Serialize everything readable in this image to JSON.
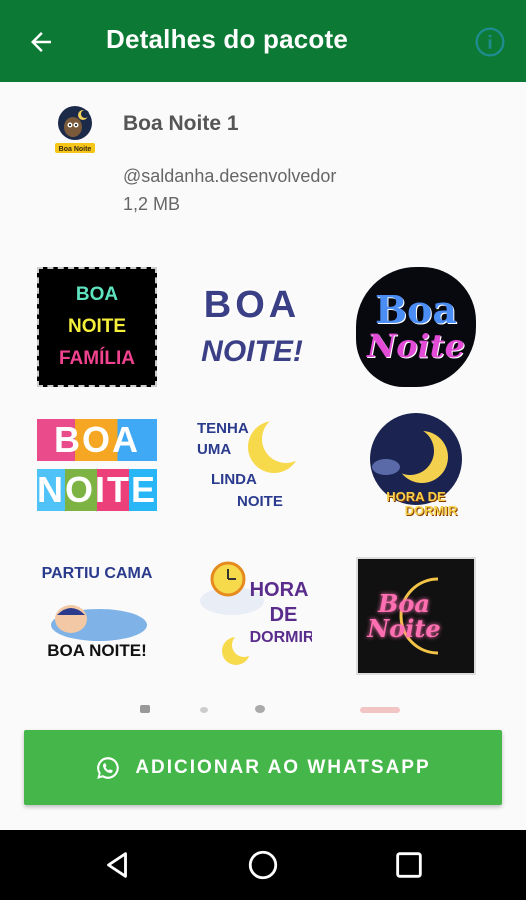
{
  "appbar": {
    "title": "Detalhes do pacote",
    "back_icon": "arrow-back-icon",
    "info_icon": "info-icon",
    "color": "#0c7a34",
    "info_color": "#1e8c8f"
  },
  "pack": {
    "name": "Boa Noite 1",
    "author": "@saldanha.desenvolvedor",
    "size": "1,2 MB",
    "icon_text": "Boa Noite"
  },
  "stickers": [
    {
      "lines": [
        "BOA",
        "NOITE",
        "FAMÍLIA"
      ]
    },
    {
      "lines": [
        "BOA",
        "NOITE!"
      ]
    },
    {
      "lines": [
        "Boa",
        "Noite"
      ]
    },
    {
      "lines": [
        "BOA",
        "NOITE"
      ]
    },
    {
      "lines": [
        "TENHA",
        "UMA",
        "LINDA",
        "NOITE"
      ]
    },
    {
      "lines": [
        "HORA DE",
        "DORMIR"
      ]
    },
    {
      "lines": [
        "PARTIU CAMA",
        "BOA NOITE!"
      ]
    },
    {
      "lines": [
        "HORA",
        "DE",
        "DORMIR"
      ]
    },
    {
      "lines": [
        "Boa",
        "Noite"
      ]
    }
  ],
  "add_button": {
    "label": "ADICIONAR AO WHATSAPP",
    "icon": "whatsapp-icon",
    "color": "#45b74a"
  },
  "navbar": {
    "buttons": [
      "back-triangle-icon",
      "home-circle-icon",
      "recents-square-icon"
    ]
  }
}
